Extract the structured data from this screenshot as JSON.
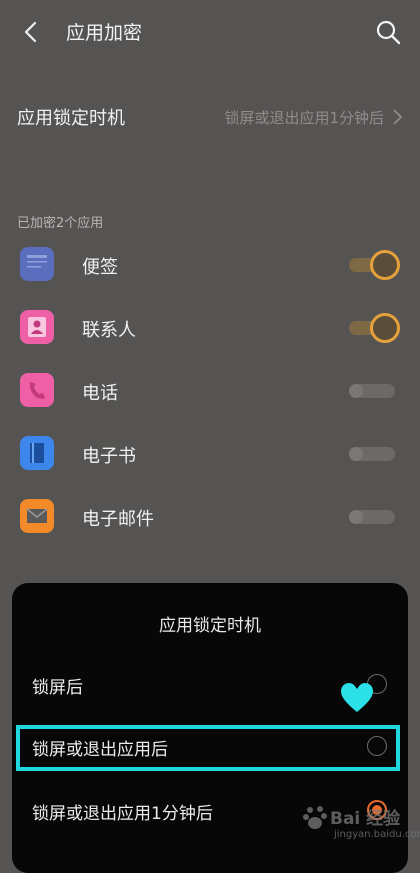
{
  "header": {
    "title": "应用加密"
  },
  "lock_timing": {
    "label": "应用锁定时机",
    "value": "锁屏或退出应用1分钟后"
  },
  "encrypted_section": {
    "label": "已加密2个应用"
  },
  "apps": [
    {
      "name": "便签",
      "icon": "note-icon",
      "color": "#5b6ebd",
      "enabled": true
    },
    {
      "name": "联系人",
      "icon": "contact-icon",
      "color": "#ef5fa6",
      "enabled": true
    },
    {
      "name": "电话",
      "icon": "phone-icon",
      "color": "#ef5fa6",
      "enabled": false
    },
    {
      "name": "电子书",
      "icon": "ebook-icon",
      "color": "#3d86ec",
      "enabled": false
    },
    {
      "name": "电子邮件",
      "icon": "mail-icon",
      "color": "#f28a2a",
      "enabled": false
    }
  ],
  "sheet": {
    "title": "应用锁定时机",
    "options": [
      {
        "label": "锁屏后",
        "selected": false
      },
      {
        "label": "锁屏或退出应用后",
        "selected": false
      },
      {
        "label": "锁屏或退出应用1分钟后",
        "selected": true
      }
    ]
  },
  "watermark": {
    "text": "Bai 经验",
    "sub": "jingyan.baidu.com"
  },
  "colors": {
    "accent": "#e6a13a",
    "highlight": "#1fd8de",
    "radio_selected": "#e86a2c"
  }
}
